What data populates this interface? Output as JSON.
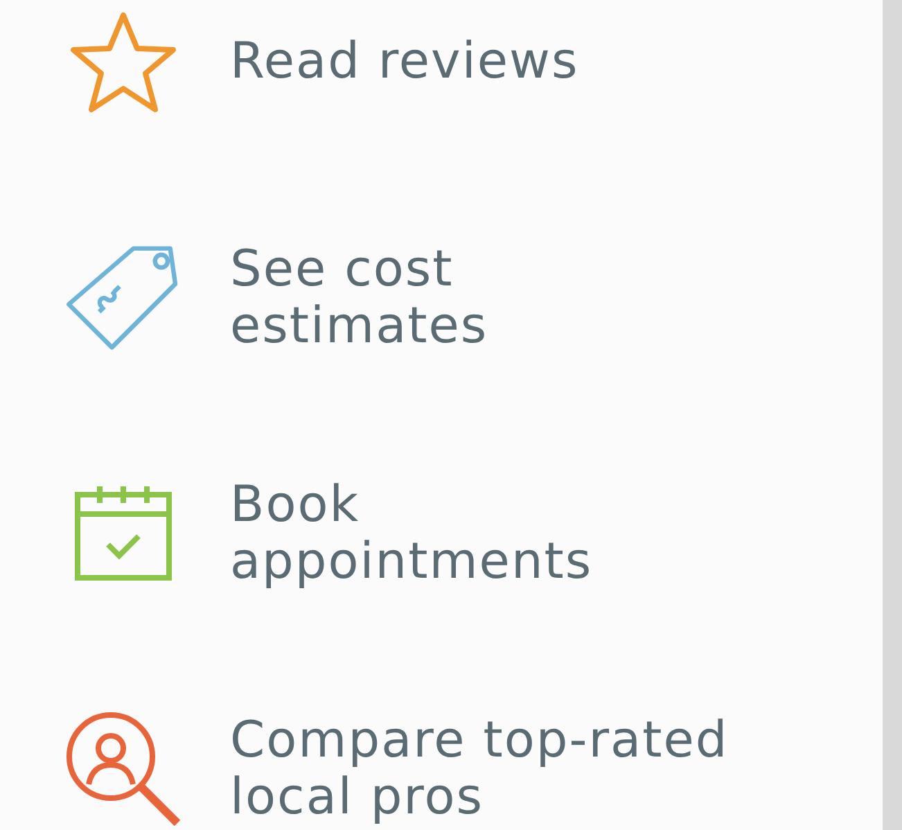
{
  "features": [
    {
      "kind": "star",
      "label": "Read reviews"
    },
    {
      "kind": "tag",
      "label": "See cost\nestimates"
    },
    {
      "kind": "calendar",
      "label": "Book\nappointments"
    },
    {
      "kind": "search-person",
      "label": "Compare top-rated\nlocal pros"
    }
  ]
}
